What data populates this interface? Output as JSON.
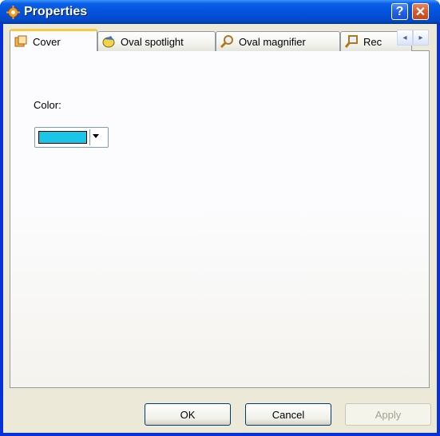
{
  "window": {
    "title": "Properties",
    "help_glyph": "?",
    "close_glyph": "✕"
  },
  "tabs": [
    {
      "label": "Cover",
      "icon": "cover-icon",
      "active": true
    },
    {
      "label": "Oval spotlight",
      "icon": "spotlight-icon",
      "active": false
    },
    {
      "label": "Oval magnifier",
      "icon": "magnifier-icon",
      "active": false
    },
    {
      "label": "Rec",
      "icon": "rect-magnifier-icon",
      "active": false
    }
  ],
  "tab_scroll": {
    "left_glyph": "◂",
    "right_glyph": "▸"
  },
  "cover": {
    "color_label": "Color:",
    "color_value": "#19c6e8"
  },
  "buttons": {
    "ok": "OK",
    "cancel": "Cancel",
    "apply": "Apply"
  },
  "colors": {
    "title_blue": "#0453dd",
    "dialog_bg": "#ece9d8",
    "active_tab_accent": "#ffc83c"
  }
}
